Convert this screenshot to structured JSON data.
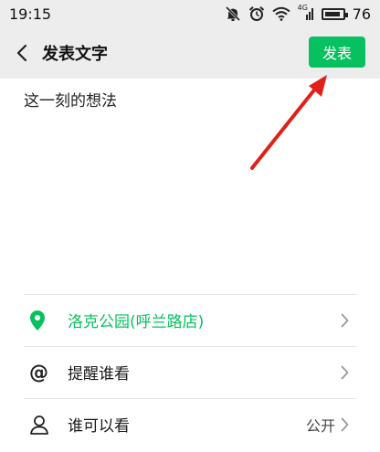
{
  "status_bar": {
    "time": "19:15",
    "battery_percent": "76",
    "network_label": "4G"
  },
  "header": {
    "title": "发表文字",
    "publish_label": "发表"
  },
  "composer": {
    "placeholder": "这一刻的想法"
  },
  "options": {
    "location": "洛克公园(呼兰路店)",
    "remind": "提醒谁看",
    "visibility": "谁可以看",
    "visibility_value": "公开"
  },
  "colors": {
    "accent": "#07c160",
    "bar_bg": "#ededed",
    "annotation_arrow": "#e0201b"
  }
}
